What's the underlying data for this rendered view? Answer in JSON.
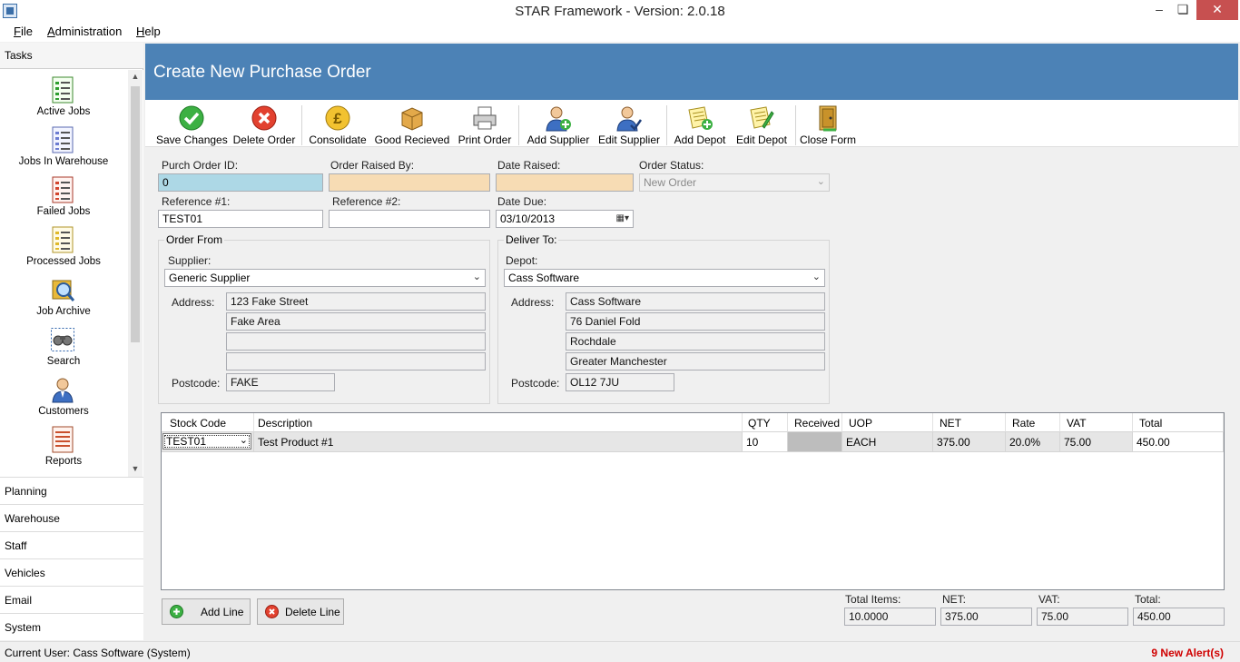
{
  "window": {
    "title": "STAR Framework - Version: 2.0.18",
    "minimize": "–",
    "maximize": "❏",
    "close": "✕"
  },
  "menu": [
    "File",
    "Administration",
    "Help"
  ],
  "sidebar": {
    "header": "Tasks",
    "tasks": [
      {
        "label": "Active Jobs",
        "icon": "document-list-green-icon"
      },
      {
        "label": "Jobs In Warehouse",
        "icon": "document-list-blue-icon"
      },
      {
        "label": "Failed Jobs",
        "icon": "document-list-red-icon"
      },
      {
        "label": "Processed Jobs",
        "icon": "document-list-yellow-icon"
      },
      {
        "label": "Job Archive",
        "icon": "archive-magnifier-icon"
      },
      {
        "label": "Search",
        "icon": "binoculars-icon"
      },
      {
        "label": "Customers",
        "icon": "person-icon"
      },
      {
        "label": "Reports",
        "icon": "report-icon"
      }
    ],
    "categories": [
      "Planning",
      "Warehouse",
      "Staff",
      "Vehicles",
      "Email",
      "System"
    ]
  },
  "form": {
    "title": "Create New Purchase Order",
    "toolbar": [
      {
        "label": "Save Changes",
        "icon": "checkmark-icon"
      },
      {
        "label": "Delete Order",
        "icon": "delete-x-icon"
      },
      {
        "label": "Consolidate",
        "icon": "pound-coin-icon"
      },
      {
        "label": "Good Recieved",
        "icon": "box-icon"
      },
      {
        "label": "Print Order",
        "icon": "printer-icon"
      },
      {
        "label": "Add Supplier",
        "icon": "add-person-icon"
      },
      {
        "label": "Edit Supplier",
        "icon": "edit-person-icon"
      },
      {
        "label": "Add Depot",
        "icon": "add-note-icon"
      },
      {
        "label": "Edit Depot",
        "icon": "edit-note-icon"
      },
      {
        "label": "Close Form",
        "icon": "exit-door-icon"
      }
    ],
    "fields": {
      "order_id_label": "Purch Order ID:",
      "order_id": "0",
      "raised_by_label": "Order Raised By:",
      "raised_by": "",
      "date_raised_label": "Date Raised:",
      "date_raised": "",
      "status_label": "Order Status:",
      "status": "New Order",
      "ref1_label": "Reference #1:",
      "ref1": "TEST01",
      "ref2_label": "Reference #2:",
      "ref2": "",
      "date_due_label": "Date Due:",
      "date_due": "03/10/2013"
    },
    "order_from": {
      "title": "Order From",
      "supplier_label": "Supplier:",
      "supplier": "Generic Supplier",
      "address_label": "Address:",
      "address": [
        "123 Fake Street",
        "Fake Area",
        "",
        ""
      ],
      "postcode_label": "Postcode:",
      "postcode": "FAKE"
    },
    "deliver_to": {
      "title": "Deliver To:",
      "depot_label": "Depot:",
      "depot": "Cass Software",
      "address_label": "Address:",
      "address": [
        "Cass Software",
        "76 Daniel Fold",
        "Rochdale",
        "Greater Manchester"
      ],
      "postcode_label": "Postcode:",
      "postcode": "OL12 7JU"
    },
    "grid": {
      "columns": [
        "Stock Code",
        "Description",
        "QTY",
        "Received",
        "UOP",
        "NET",
        "Rate",
        "VAT",
        "Total"
      ],
      "rows": [
        {
          "stock_code": "TEST01",
          "description": "Test Product #1",
          "qty": "10",
          "received": "",
          "uop": "EACH",
          "net": "375.00",
          "rate": "20.0%",
          "vat": "75.00",
          "total": "450.00"
        }
      ]
    },
    "buttons": {
      "add_line": "Add Line",
      "delete_line": "Delete Line"
    },
    "totals": {
      "items_label": "Total Items:",
      "items": "10.0000",
      "net_label": "NET:",
      "net": "375.00",
      "vat_label": "VAT:",
      "vat": "75.00",
      "total_label": "Total:",
      "total": "450.00"
    }
  },
  "status": {
    "user": "Current User: Cass Software (System)",
    "alerts": "9 New Alert(s)",
    "alert_color": "#d00000"
  }
}
